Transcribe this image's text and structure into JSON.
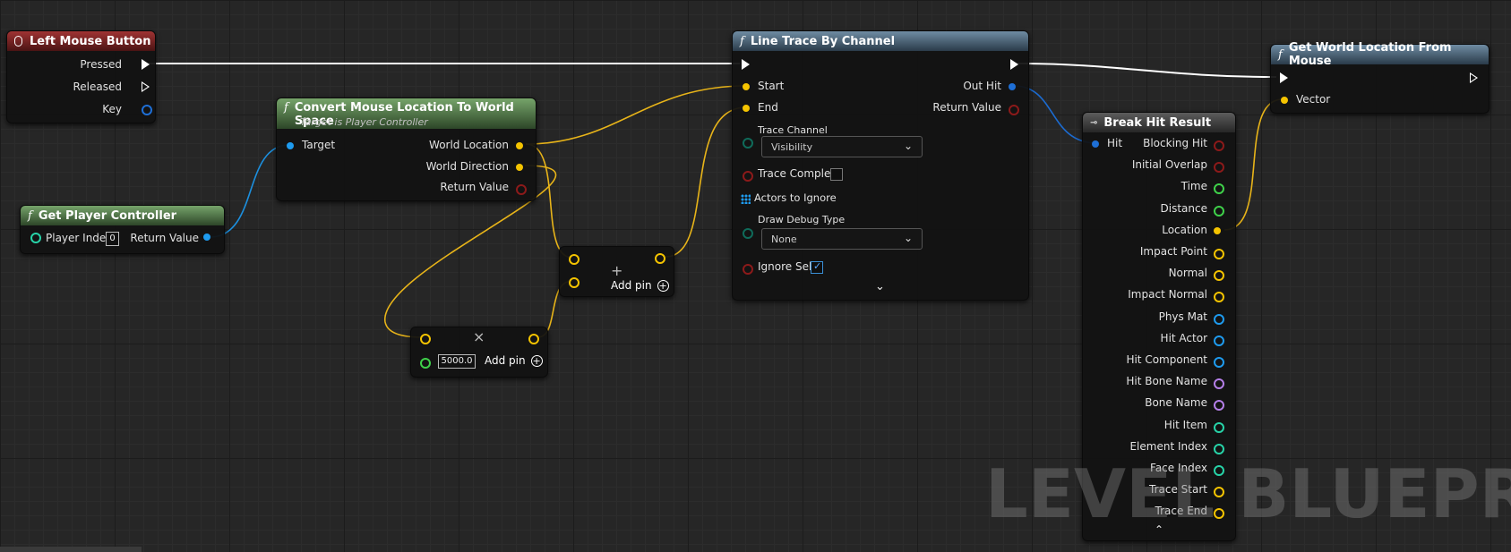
{
  "watermark": "LEVEL BLUEPRINT",
  "nodes": {
    "left_mouse": {
      "title": "Left Mouse Button",
      "pins": {
        "pressed": "Pressed",
        "released": "Released",
        "key": "Key"
      }
    },
    "get_player_controller": {
      "title": "Get Player Controller",
      "player_index_label": "Player Index",
      "player_index_value": "0",
      "return_value": "Return Value"
    },
    "convert_mouse": {
      "title": "Convert Mouse Location To World Space",
      "subtitle": "Target is Player Controller",
      "target": "Target",
      "world_location": "World Location",
      "world_direction": "World Direction",
      "return_value": "Return Value"
    },
    "multiply": {
      "value": "5000.0",
      "add_pin": "Add pin",
      "operator": "×"
    },
    "add": {
      "add_pin": "Add pin",
      "operator": "+"
    },
    "line_trace": {
      "title": "Line Trace By Channel",
      "start": "Start",
      "end": "End",
      "out_hit": "Out Hit",
      "return_value": "Return Value",
      "trace_channel_label": "Trace Channel",
      "trace_channel_value": "Visibility",
      "trace_complex": "Trace Complex",
      "actors_to_ignore": "Actors to Ignore",
      "draw_debug_label": "Draw Debug Type",
      "draw_debug_value": "None",
      "ignore_self": "Ignore Self"
    },
    "break_hit": {
      "title": "Break Hit Result",
      "hit": "Hit",
      "outputs": [
        "Blocking Hit",
        "Initial Overlap",
        "Time",
        "Distance",
        "Location",
        "Impact Point",
        "Normal",
        "Impact Normal",
        "Phys Mat",
        "Hit Actor",
        "Hit Component",
        "Hit Bone Name",
        "Bone Name",
        "Hit Item",
        "Element Index",
        "Face Index",
        "Trace Start",
        "Trace End"
      ]
    },
    "get_world_location": {
      "title": "Get World Location From Mouse",
      "vector": "Vector"
    }
  },
  "colors": {
    "exec": "#ffffff",
    "vector": "#f5c400",
    "object": "#1e9bef",
    "bool": "#8c1a1a",
    "float": "#3fd14a",
    "int": "#27d3a8",
    "name": "#b57fe8",
    "struct": "#1e6fd6",
    "wire_exec": "#ffffff",
    "wire_vector": "#e8b419",
    "wire_object": "#1c8fde"
  }
}
